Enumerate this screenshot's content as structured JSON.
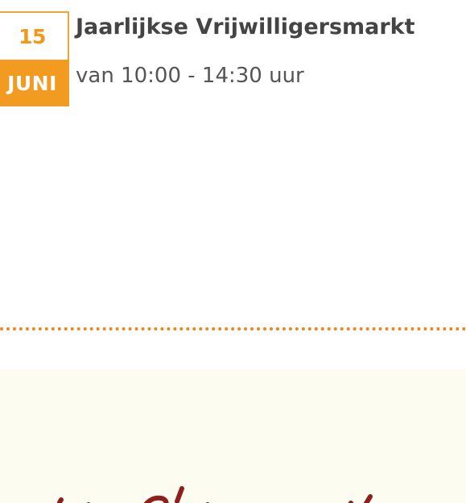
{
  "event": {
    "day": "15",
    "month": "JUNI",
    "title": "Jaarlijkse Vrijwilligersmarkt",
    "time": "van 10:00 - 14:30 uur"
  },
  "colors": {
    "accent": "#f39b20",
    "divider": "#e8891e",
    "script_heading": "#8e1f1c",
    "section_background": "#fdfcf1"
  }
}
